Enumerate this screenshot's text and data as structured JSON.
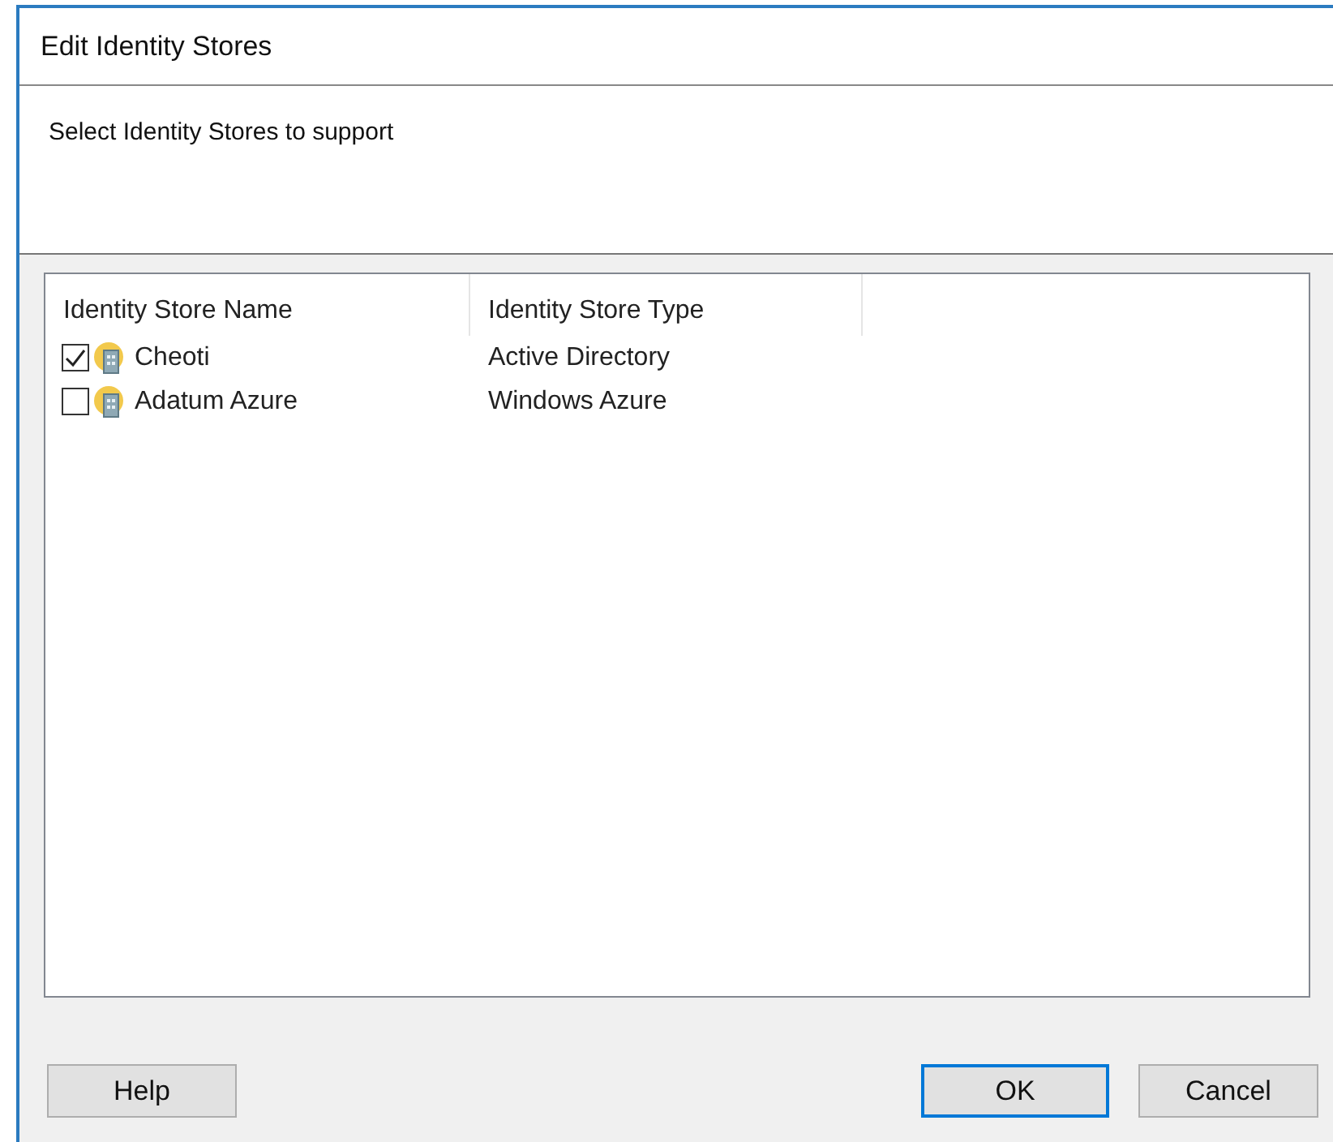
{
  "window": {
    "title": "Edit Identity Stores"
  },
  "description": "Select Identity Stores to support",
  "table": {
    "columns": [
      "Identity Store Name",
      "Identity Store Type"
    ],
    "rows": [
      {
        "name": "Cheoti",
        "type": "Active Directory",
        "checked": true
      },
      {
        "name": "Adatum Azure",
        "type": "Windows Azure",
        "checked": false
      }
    ]
  },
  "buttons": [
    {
      "label": "Help",
      "default": false
    },
    {
      "label": "OK",
      "default": true
    },
    {
      "label": "Cancel",
      "default": false
    }
  ]
}
